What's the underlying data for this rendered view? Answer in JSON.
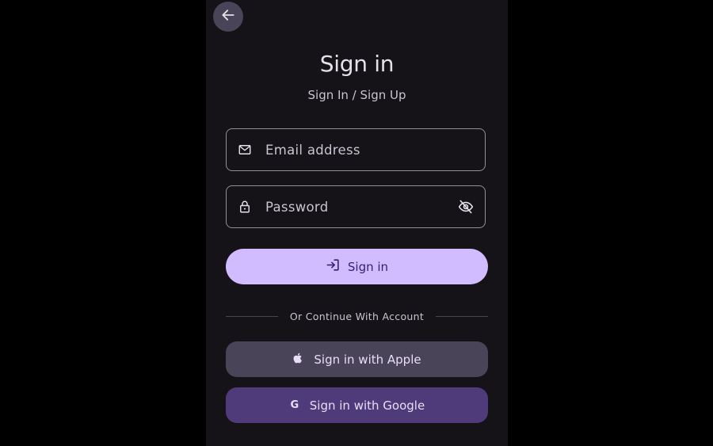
{
  "header": {
    "back_icon": "arrow-left-icon",
    "title": "Sign in",
    "subtitle": "Sign In / Sign Up"
  },
  "form": {
    "email": {
      "icon": "mail-icon",
      "placeholder": "Email address",
      "value": ""
    },
    "password": {
      "icon": "lock-icon",
      "placeholder": "Password",
      "value": "",
      "toggle_icon": "eye-off-icon"
    },
    "submit": {
      "icon": "login-icon",
      "label": "Sign in"
    }
  },
  "divider": {
    "text": "Or Continue With Account"
  },
  "social": {
    "apple": {
      "icon": "apple-icon",
      "label": "Sign in with Apple"
    },
    "google": {
      "icon": "google-icon",
      "glyph": "G",
      "label": "Sign in with Google"
    }
  },
  "colors": {
    "background": "#151318",
    "primary": "#d0bcff",
    "on_primary": "#381e72",
    "secondary_container": "#4a4458",
    "google_button": "#4f3a7a",
    "outline": "#938f99",
    "text": "#e6e0e9",
    "text_muted": "#cac4d0"
  }
}
